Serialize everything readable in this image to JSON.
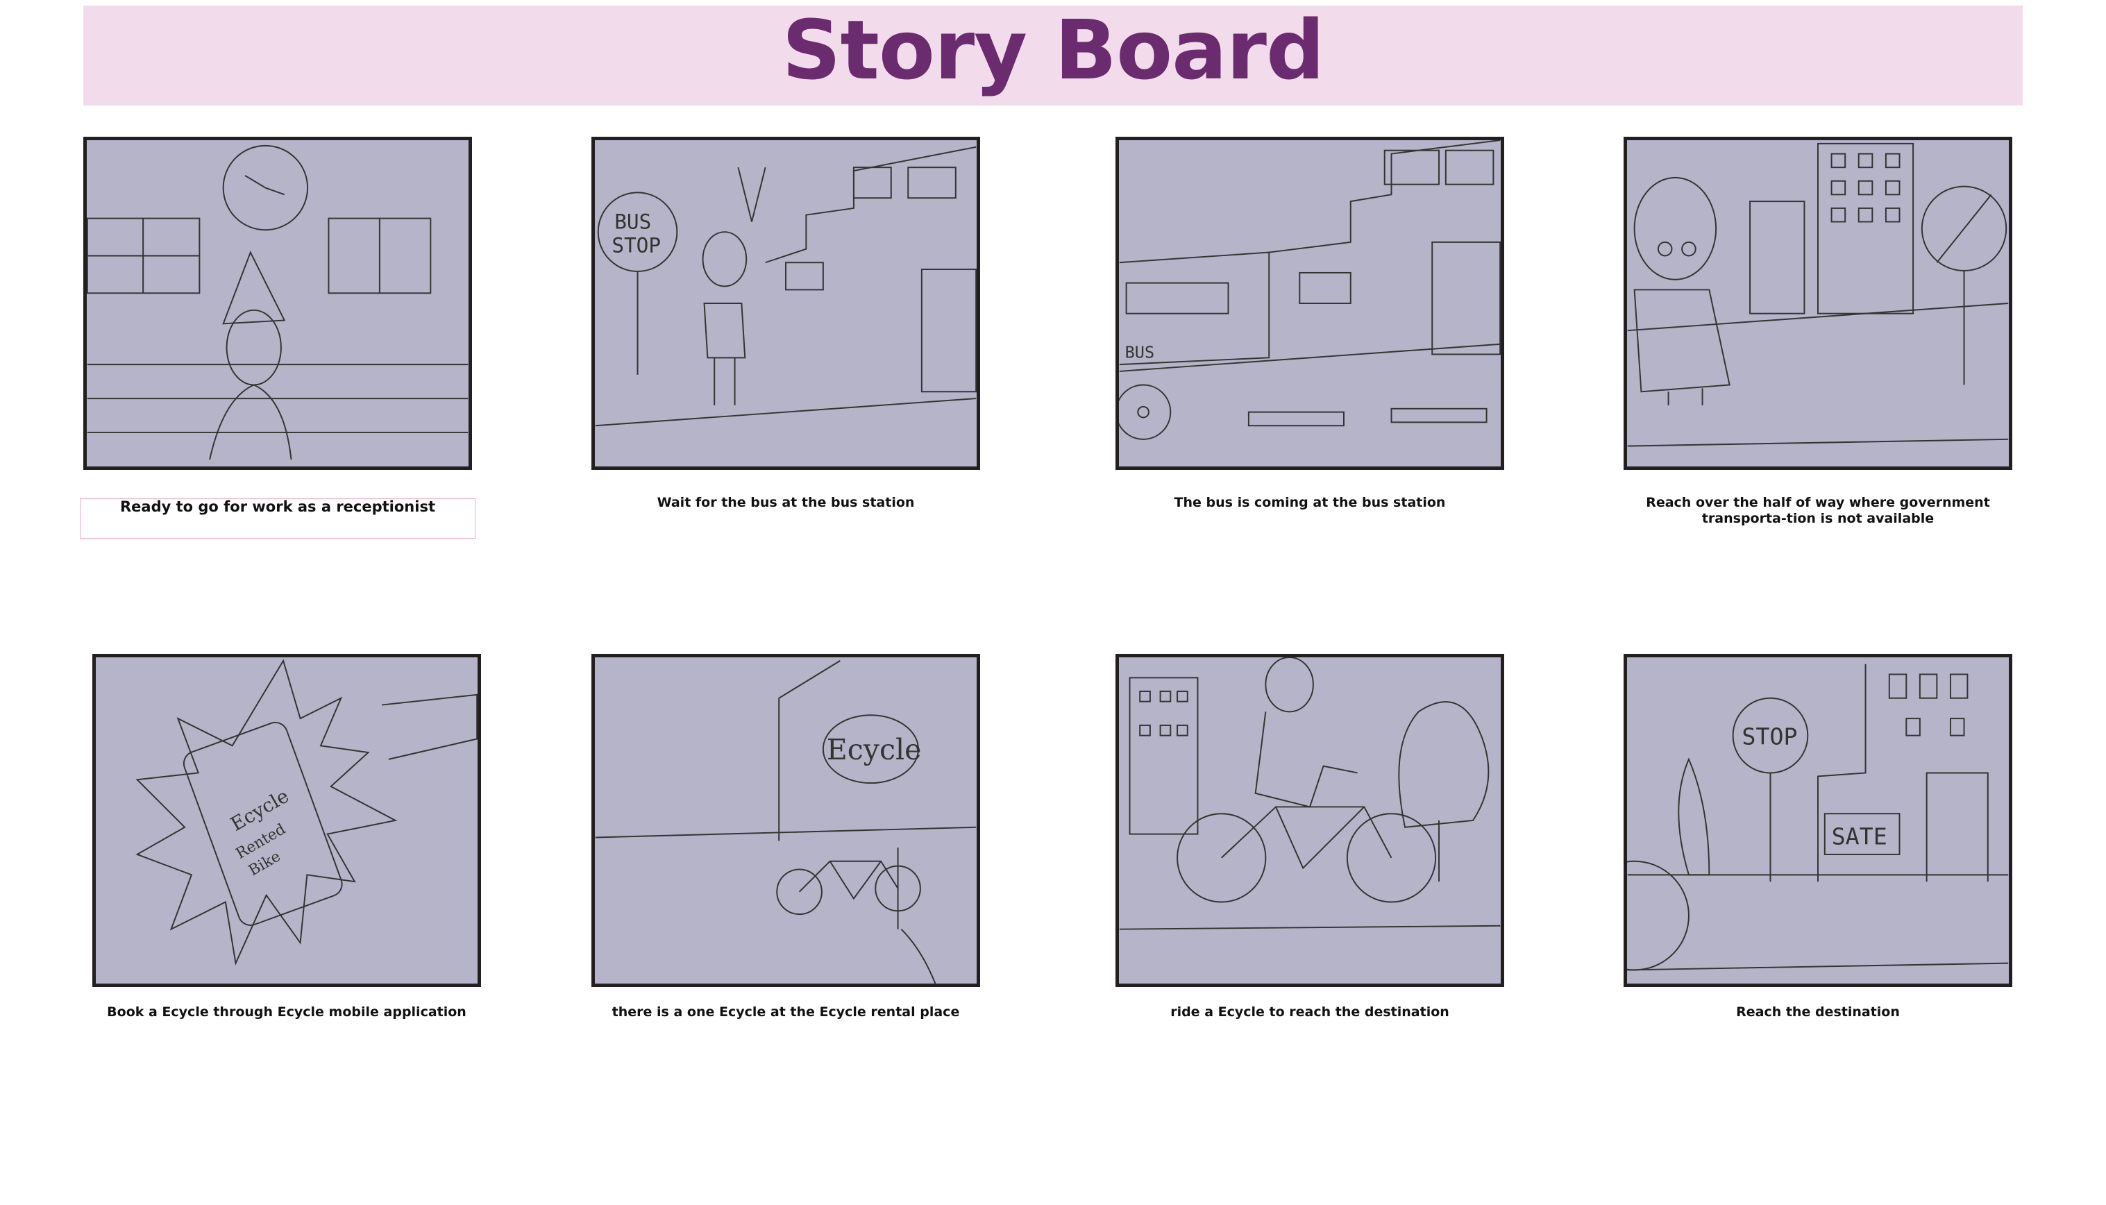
{
  "title": "Story Board",
  "panels": [
    {
      "caption": "Ready to go for work as a receptionist",
      "icon": "woman-clock-sketch-icon"
    },
    {
      "caption": "Wait for the bus at the bus station",
      "icon": "bus-stop-sketch-icon",
      "sign_lines": [
        "BUS",
        "STOP"
      ]
    },
    {
      "caption": "The bus is coming at the bus station",
      "icon": "bus-arriving-sketch-icon",
      "label": "BUS"
    },
    {
      "caption": "Reach over the half of way where government transporta-tion is not available",
      "icon": "no-bus-sign-sketch-icon"
    },
    {
      "caption": "Book a Ecycle through Ecycle mobile application",
      "icon": "phone-app-sketch-icon",
      "lines": [
        "Ecycle",
        "Rented",
        "Bike"
      ]
    },
    {
      "caption": "there is a one Ecycle at the Ecycle rental place",
      "icon": "rental-place-sketch-icon",
      "label": "Ecycle"
    },
    {
      "caption": "ride a Ecycle to reach the destination",
      "icon": "cyclist-sketch-icon"
    },
    {
      "caption": "Reach the destination",
      "icon": "destination-sketch-icon",
      "sign": "STOP",
      "store": "SATE"
    }
  ]
}
